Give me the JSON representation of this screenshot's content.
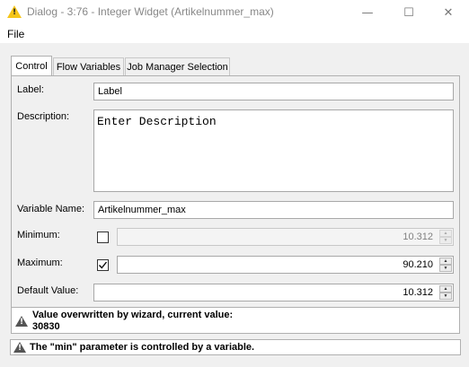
{
  "window": {
    "title": "Dialog - 3:76 - Integer Widget (Artikelnummer_max)",
    "minimize_icon": "minimize-icon",
    "maximize_icon": "maximize-icon",
    "close_icon": "close-icon"
  },
  "menu": {
    "file": "File"
  },
  "tabs": [
    {
      "label": "Control",
      "active": true
    },
    {
      "label": "Flow Variables",
      "active": false
    },
    {
      "label": "Job Manager Selection",
      "active": false
    }
  ],
  "form": {
    "label_caption": "Label:",
    "label_value": "Label",
    "description_caption": "Description:",
    "description_value": "Enter Description",
    "variable_name_caption": "Variable Name:",
    "variable_name_value": "Artikelnummer_max",
    "minimum_caption": "Minimum:",
    "minimum_checked": false,
    "minimum_value": "10.312",
    "maximum_caption": "Maximum:",
    "maximum_checked": true,
    "maximum_value": "90.210",
    "default_caption": "Default Value:",
    "default_value": "10.312"
  },
  "warnings": {
    "wizard_line1": "Value overwritten by wizard, current value:",
    "wizard_line2": "30830",
    "min_controlled": "The \"min\" parameter is controlled by a variable."
  },
  "colors": {
    "warning_icon": "#f5c518",
    "panel_bg": "#f0f0f0"
  }
}
